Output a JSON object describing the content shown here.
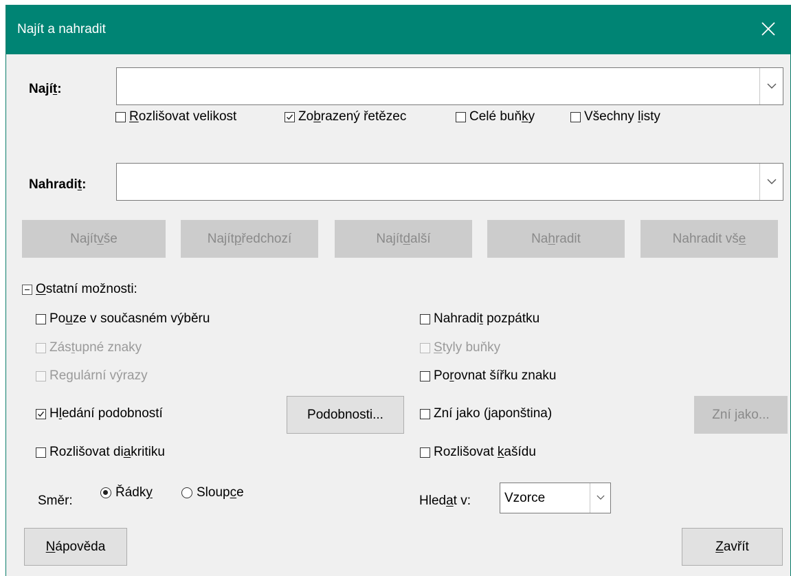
{
  "window": {
    "title": "Najít a nahradit"
  },
  "find": {
    "label_pre": "Nají",
    "label_u": "t",
    "label_post": ":",
    "value": "",
    "options": {
      "case": {
        "pre": "",
        "u": "R",
        "post": "ozlišovat velikost",
        "checked": false
      },
      "formatted": {
        "pre": "Zo",
        "u": "b",
        "post": "razený řetězec",
        "checked": true
      },
      "entire": {
        "pre": "Celé buň",
        "u": "k",
        "post": "y",
        "checked": false
      },
      "allsheets": {
        "pre": "Všechny ",
        "u": "l",
        "post": "isty",
        "checked": false
      }
    }
  },
  "replace": {
    "label_pre": "Nahradi",
    "label_u": "t",
    "label_post": ":",
    "value": ""
  },
  "buttons": {
    "find_all": {
      "pre": "Najít ",
      "u": "v",
      "post": "še"
    },
    "find_prev": {
      "pre": "Najít ",
      "u": "p",
      "post": "ředchozí"
    },
    "find_next": {
      "pre": "Najít ",
      "u": "d",
      "post": "alší"
    },
    "replace": {
      "pre": "Na",
      "u": "h",
      "post": "radit"
    },
    "replace_all": {
      "pre": "Nahradit vš",
      "u": "e",
      "post": ""
    }
  },
  "other": {
    "toggle_u": "O",
    "toggle_post": "statní možnosti:",
    "selection_only": {
      "pre": "Po",
      "u": "u",
      "post": "ze v současném výběru",
      "checked": false
    },
    "wildcards": {
      "pre": "Zás",
      "u": "t",
      "post": "upné znaky",
      "checked": false
    },
    "regex": {
      "pre": "Re",
      "u": "g",
      "post": "ulární výrazy",
      "checked": false
    },
    "similarity": {
      "pre": "H",
      "u": "l",
      "post": "edání podobností",
      "checked": true
    },
    "similarity_btn": "Podobnosti...",
    "diacritics": {
      "pre": "Rozlišovat di",
      "u": "a",
      "post": "kritiku",
      "checked": false
    },
    "backwards": {
      "pre": "Nahradi",
      "u": "t",
      "post": " pozpátku",
      "checked": false
    },
    "cell_styles": {
      "pre": "",
      "u": "S",
      "post": "tyly buňky",
      "checked": false
    },
    "width": {
      "pre": "Po",
      "u": "r",
      "post": "ovnat šířku znaku",
      "checked": false
    },
    "soundslike": {
      "pre": "Zní ",
      "u": "j",
      "post": "ako (japonština)",
      "checked": false
    },
    "soundslike_btn": "Zní jako...",
    "kashida": {
      "pre": "Rozlišovat ",
      "u": "k",
      "post": "ašídu",
      "checked": false
    },
    "direction_label": "Směr:",
    "rows": {
      "pre": "Řádk",
      "u": "y",
      "post": "",
      "selected": true
    },
    "columns": {
      "pre": "Sloup",
      "u": "c",
      "post": "e",
      "selected": false
    },
    "search_in_pre": "Hled",
    "search_in_u": "a",
    "search_in_post": "t v:",
    "search_in_value": "Vzorce"
  },
  "footer": {
    "help": {
      "pre": "",
      "u": "N",
      "post": "ápověda"
    },
    "close": {
      "pre": "",
      "u": "Z",
      "post": "avřít"
    }
  }
}
